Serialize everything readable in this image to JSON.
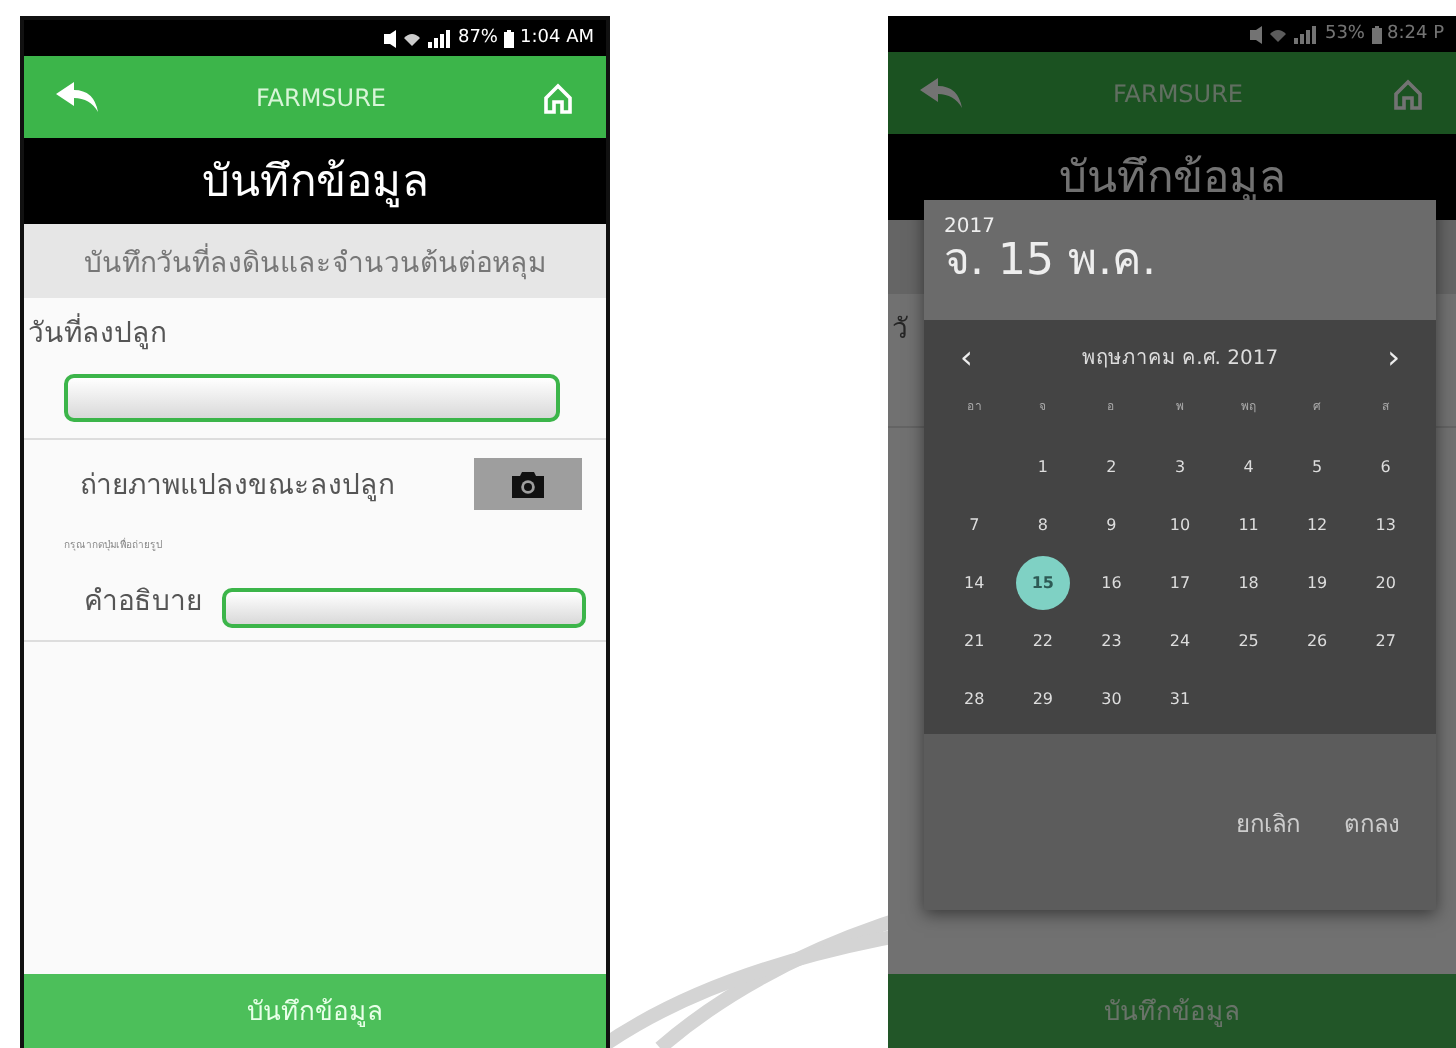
{
  "screens": [
    {
      "status": {
        "battery": "87%",
        "time": "1:04 AM"
      },
      "app_bar": {
        "title": "FARMSURE"
      },
      "page_title": "บันทึกข้อมูล",
      "form": {
        "subtitle": "บันทึกวันที่ลงดินและจำนวนต้นต่อหลุม",
        "date_label": "วันที่ลงปลูก",
        "photo_label": "ถ่ายภาพแปลงขณะลงปลูก",
        "photo_hint": "กรุณากดปุ่มเพื่อถ่ายรูป",
        "description_label": "คำอธิบาย"
      },
      "save_button": "บันทึกข้อมูล"
    },
    {
      "status": {
        "battery": "53%",
        "time": "8:24 P"
      },
      "app_bar": {
        "title": "FARMSURE"
      },
      "page_title": "บันทึกข้อมูล",
      "form": {
        "date_label": "วั"
      },
      "save_button": "บันทึกข้อมูล",
      "dialog": {
        "year": "2017",
        "date": "จ. 15 พ.ค.",
        "month": "พฤษภาคม ค.ศ. 2017",
        "prev": "‹",
        "next": "›",
        "weekdays": [
          "อา",
          "จ",
          "อ",
          "พ",
          "พฤ",
          "ศ",
          "ส"
        ],
        "weeks": [
          [
            {
              "label": "1",
              "selected": false
            },
            {
              "label": "2",
              "selected": false
            },
            {
              "label": "3",
              "selected": false
            },
            {
              "label": "4",
              "selected": false
            },
            {
              "label": "5",
              "selected": false
            },
            {
              "label": "6",
              "selected": false
            }
          ],
          [
            {
              "label": "7",
              "selected": false
            },
            {
              "label": "8",
              "selected": false
            },
            {
              "label": "9",
              "selected": false
            },
            {
              "label": "10",
              "selected": false
            },
            {
              "label": "11",
              "selected": false
            },
            {
              "label": "12",
              "selected": false
            },
            {
              "label": "13",
              "selected": false
            }
          ],
          [
            {
              "label": "14",
              "selected": false
            },
            {
              "label": "15",
              "selected": true
            },
            {
              "label": "16",
              "selected": false
            },
            {
              "label": "17",
              "selected": false
            },
            {
              "label": "18",
              "selected": false
            },
            {
              "label": "19",
              "selected": false
            },
            {
              "label": "20",
              "selected": false
            }
          ],
          [
            {
              "label": "21",
              "selected": false
            },
            {
              "label": "22",
              "selected": false
            },
            {
              "label": "23",
              "selected": false
            },
            {
              "label": "24",
              "selected": false
            },
            {
              "label": "25",
              "selected": false
            },
            {
              "label": "26",
              "selected": false
            },
            {
              "label": "27",
              "selected": false
            }
          ],
          [
            {
              "label": "28",
              "selected": false
            },
            {
              "label": "29",
              "selected": false
            },
            {
              "label": "30",
              "selected": false
            },
            {
              "label": "31",
              "selected": false
            }
          ]
        ],
        "buttons": [
          "ยกเลิก",
          "ตกลง"
        ]
      }
    }
  ]
}
